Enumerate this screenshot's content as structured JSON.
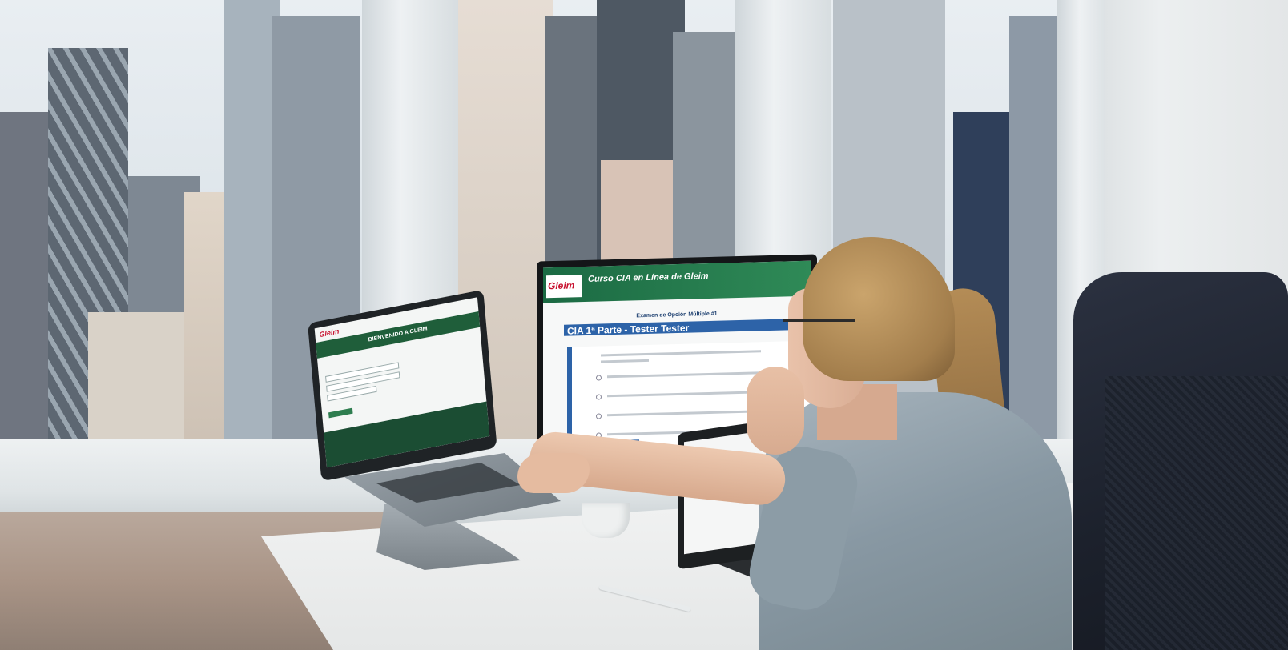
{
  "photo": {
    "laptop": {
      "logo": "Gleim",
      "banner": "BIENVENIDO A GLEIM"
    },
    "monitor": {
      "logo": "Gleim",
      "course_title": "Curso CIA en Línea de Gleim",
      "exam_title": "Examen de Opción Múltiple #1",
      "part_title": "CIA 1ª Parte - Tester Tester"
    }
  }
}
